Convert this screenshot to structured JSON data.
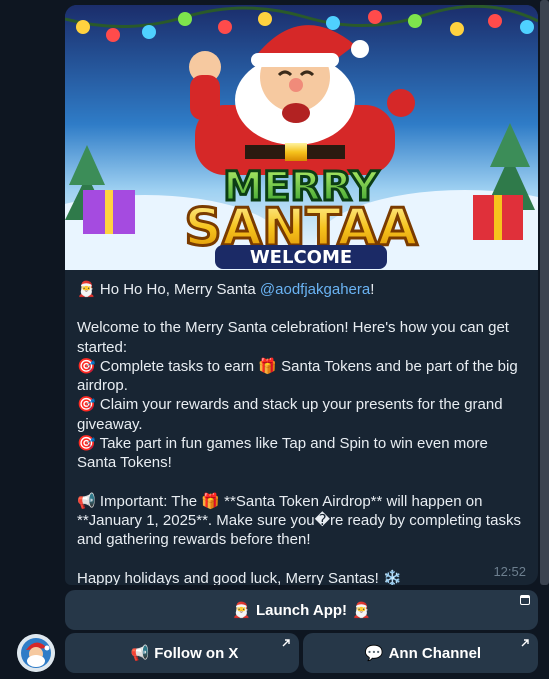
{
  "message": {
    "banner": {
      "line1": "MERRY",
      "line2": "SANTAA",
      "line3": "WELCOME"
    },
    "greeting_prefix": "Ho Ho Ho, Merry Santa ",
    "mention": "@aodfjakgahera",
    "greeting_suffix": "!",
    "intro": "Welcome to the Merry Santa celebration! Here's how you can get started:",
    "item1_a": "Complete tasks to earn ",
    "item1_b": " Santa Tokens and be part of the big airdrop.",
    "item2": "Claim your rewards and stack up your presents for the grand giveaway.",
    "item3": "Take part in fun games like Tap and Spin to win even more Santa Tokens!",
    "important_a": "Important: The ",
    "important_b": " **Santa Token Airdrop** will happen on **January 1, 2025**. Make sure you�re ready by completing tasks and gathering rewards before then!",
    "closing": "Happy holidays and good luck, Merry Santas! ",
    "time": "12:52"
  },
  "buttons": {
    "launch_app": "Launch App!",
    "follow_x": "Follow on X",
    "ann_channel": "Ann Channel"
  },
  "icons": {
    "santa": "santa-emoji",
    "target": "direct-hit-emoji",
    "gift": "wrapped-gift-emoji",
    "megaphone": "megaphone-emoji",
    "snowflake": "snowflake-emoji",
    "speech": "speech-balloon-emoji"
  },
  "colors": {
    "background": "#0e1621",
    "bubble": "#182533",
    "button": "#263748",
    "link": "#6ab3f3",
    "text": "#e8edf2",
    "timestamp": "#6d7f8f"
  }
}
